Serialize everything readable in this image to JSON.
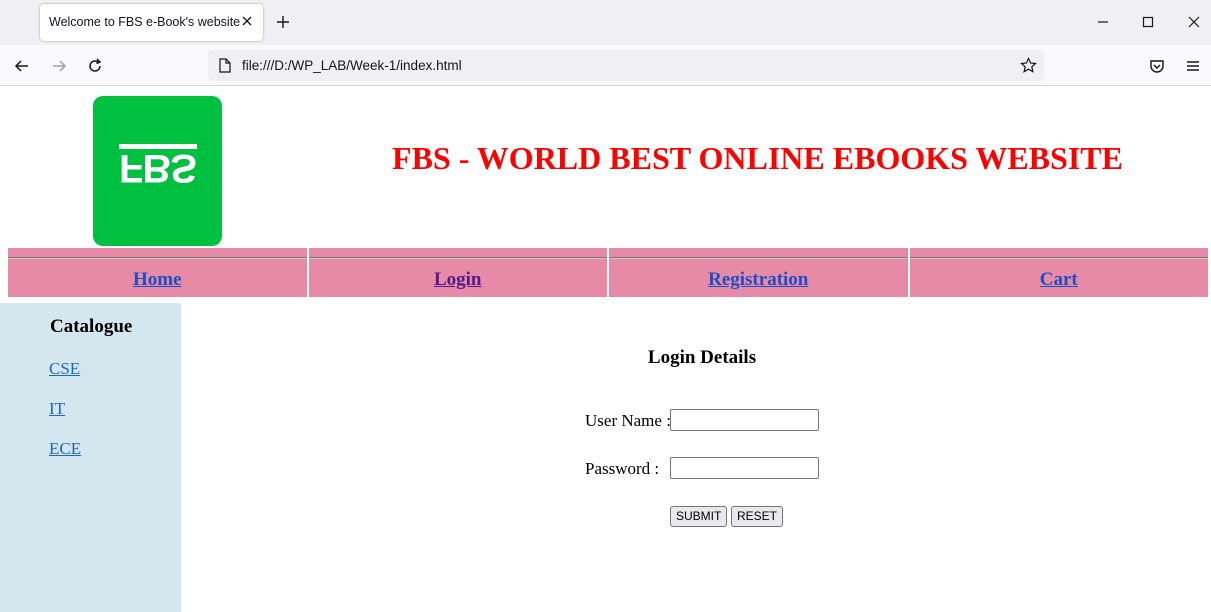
{
  "browser": {
    "tab_title": "Welcome to FBS e-Book's website",
    "url": "file:///D:/WP_LAB/Week-1/index.html"
  },
  "header": {
    "logo_text": "FBS",
    "site_title": "FBS - WORLD BEST ONLINE EBOOKS WEBSITE",
    "title_color": "#ff0000",
    "logo_color": "#00c040"
  },
  "menu": {
    "items": [
      {
        "label": "Home"
      },
      {
        "label": "Login"
      },
      {
        "label": "Registration"
      },
      {
        "label": "Cart"
      }
    ],
    "background": "#e68aa8"
  },
  "sidebar": {
    "title": "Catalogue",
    "links": [
      {
        "label": "CSE"
      },
      {
        "label": "IT"
      },
      {
        "label": "ECE"
      }
    ],
    "background": "#d5e7ee"
  },
  "login": {
    "heading": "Login Details",
    "username_label": "User Name :",
    "password_label": "Password :",
    "username_value": "",
    "password_value": "",
    "submit_label": "SUBMIT",
    "reset_label": "RESET"
  }
}
